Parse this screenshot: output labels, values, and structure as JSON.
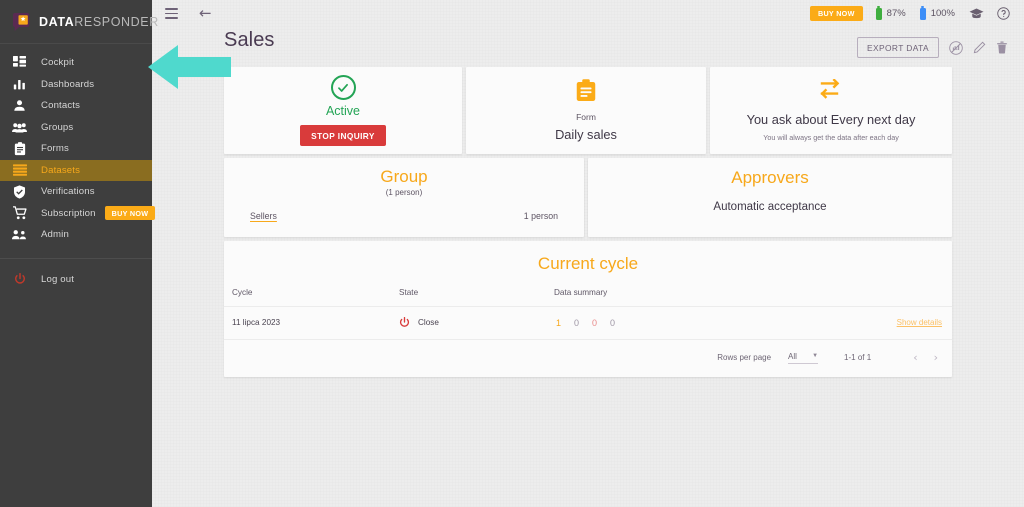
{
  "brand": {
    "name_bold": "DATA",
    "name_light": "RESPONDER",
    "logo_icon": "speech-head-star-logo"
  },
  "sidebar": {
    "items": [
      {
        "label": "Cockpit",
        "icon": "dashboard-grid-icon",
        "active": false
      },
      {
        "label": "Dashboards",
        "icon": "bar-chart-icon",
        "active": false
      },
      {
        "label": "Contacts",
        "icon": "person-icon",
        "active": false
      },
      {
        "label": "Groups",
        "icon": "people-group-icon",
        "active": false
      },
      {
        "label": "Forms",
        "icon": "clipboard-icon",
        "active": false
      },
      {
        "label": "Datasets",
        "icon": "list-lines-icon",
        "active": true
      },
      {
        "label": "Verifications",
        "icon": "shield-check-icon",
        "active": false
      },
      {
        "label": "Subscription",
        "icon": "shopping-cart-icon",
        "active": false,
        "badge": "BUY NOW"
      },
      {
        "label": "Admin",
        "icon": "people-admin-icon",
        "active": false
      }
    ],
    "logout": {
      "label": "Log out",
      "icon": "power-icon"
    }
  },
  "topbar": {
    "menu_icon": "hamburger-icon",
    "back_icon": "back-arrow-icon",
    "buy_now": "BUY NOW",
    "stats": [
      {
        "value": "87%",
        "color": "#3fae3f",
        "icon": "battery-icon"
      },
      {
        "value": "100%",
        "color": "#3d8ef7",
        "icon": "battery-icon"
      }
    ],
    "graduation_icon": "graduation-cap-icon",
    "help_icon": "help-circle-icon"
  },
  "header": {
    "title": "Sales",
    "export_label": "EXPORT DATA",
    "actions": [
      {
        "icon": "no-signal-circle-icon"
      },
      {
        "icon": "pencil-edit-icon"
      },
      {
        "icon": "trash-delete-icon"
      }
    ]
  },
  "cards": {
    "status": {
      "icon": "check-circle-icon",
      "label": "Active",
      "button": "STOP INQUIRY",
      "color": "#23a455"
    },
    "form": {
      "icon": "clipboard-form-icon",
      "kind": "Form",
      "name": "Daily sales"
    },
    "schedule": {
      "icon": "repeat-cycle-icon",
      "title": "You ask about Every next day",
      "subtitle": "You will always get the data after each day"
    },
    "group": {
      "title": "Group",
      "count_note": "(1 person)",
      "link": "Sellers",
      "value": "1 person"
    },
    "approvers": {
      "title": "Approvers",
      "subtitle": "Automatic acceptance"
    }
  },
  "cycle": {
    "title": "Current cycle",
    "columns": [
      "Cycle",
      "State",
      "Data summary",
      ""
    ],
    "rows": [
      {
        "cycle": "11 lipca 2023",
        "state": "Close",
        "state_icon": "power-off-icon",
        "summary": [
          {
            "value": "1",
            "color": "#f7a81b"
          },
          {
            "value": "0",
            "color": "#9e96a5"
          },
          {
            "value": "0",
            "color": "#e98a8a"
          },
          {
            "value": "0",
            "color": "#9e96a5"
          }
        ],
        "action": "Show details"
      }
    ],
    "pager": {
      "rows_per_page_label": "Rows per page",
      "rows_per_page_value": "All",
      "range": "1-1 of 1",
      "prev_icon": "chevron-left-icon",
      "next_icon": "chevron-right-icon"
    }
  },
  "annotation": {
    "arrow": "teal-left-arrow",
    "color": "#4fd9cd"
  }
}
